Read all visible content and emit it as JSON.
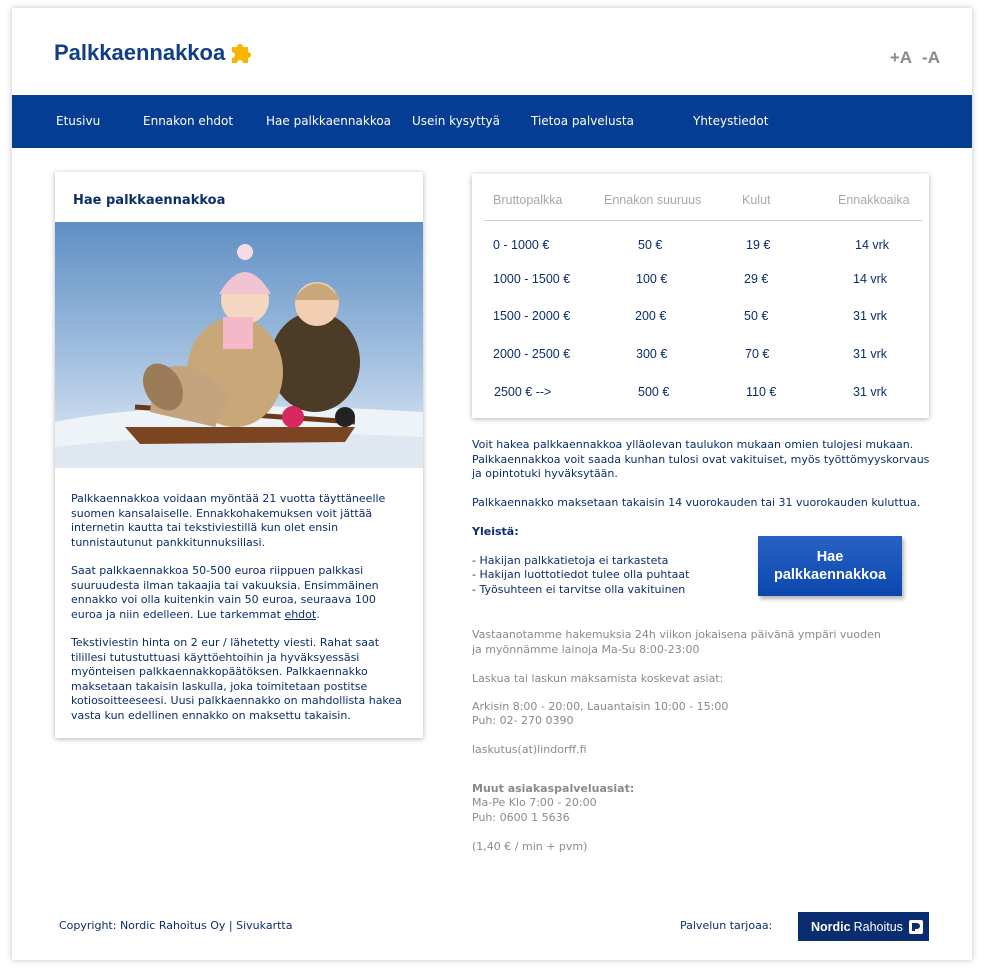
{
  "header": {
    "logo_text": "Palkkaennakkoa",
    "font_increase": "+A",
    "font_decrease": "-A"
  },
  "nav": {
    "items": [
      "Etusivu",
      "Ennakon ehdot",
      "Hae palkkaennakkoa",
      "Usein kysyttyä",
      "Tietoa palvelusta",
      "Yhteystiedot"
    ]
  },
  "left": {
    "title": "Hae palkkaennakkoa",
    "p1": "Palkkaennakkoa voidaan myöntää 21 vuotta täyttäneelle suomen kansalaiselle. Ennakkohakemuksen voit jättää internetin kautta tai tekstiviestillä kun olet ensin tunnistautunut pankkitunnuksillasi.",
    "p2_before": "Saat palkkaennakkoa 50-500 euroa riippuen palkkasi suuruudesta ilman takaajia tai vakuuksia. Ensimmäinen ennakko voi olla kuitenkin vain 50 euroa, seuraava 100 euroa ja niin edelleen. Lue tarkemmat ",
    "p2_link": "ehdot",
    "p2_after": ".",
    "p3": "Tekstiviestin hinta on 2 eur / lähetetty viesti. Rahat saat tilillesi tutustuttuasi käyttöehtoihin ja hyväksyessäsi myönteisen palkkaennakkopäätöksen. Palkkaennakko maksetaan takaisin laskulla, joka toimitetaan postitse kotiosoitteeseesi. Uusi palkkaennakko on mahdollista hakea vasta kun edellinen ennakko on maksettu takaisin."
  },
  "table": {
    "headers": [
      "Bruttopalkka",
      "Ennakon suuruus",
      "Kulut",
      "Ennakkoaika"
    ],
    "rows": [
      [
        "0 - 1000 €",
        "50 €",
        "19 €",
        "14 vrk"
      ],
      [
        "1000 - 1500 €",
        "100 €",
        "29 €",
        "14 vrk"
      ],
      [
        "1500 - 2000 €",
        "200 €",
        "50 €",
        "31 vrk"
      ],
      [
        "2000 - 2500 €",
        "300 €",
        "70 €",
        "31 vrk"
      ],
      [
        "2500 € -->",
        "500 €",
        "110 €",
        "31 vrk"
      ]
    ]
  },
  "right": {
    "intro1": "Voit hakea palkkaennakkoa ylläolevan taulukon mukaan omien tulojesi mukaan. Palkkaennakkoa voit saada kunhan tulosi ovat vakituiset, myös työttömyyskorvaus ja opintotuki hyväksytään.",
    "intro2": "Palkkaennakko maksetaan takaisin 14 vuorokauden tai 31 vuorokauden kuluttua.",
    "general_title": "Yleistä:",
    "general_items": [
      "- Hakijan palkkatietoja ei tarkasteta",
      "- Hakijan luottotiedot tulee olla puhtaat",
      "- Työsuhteen ei tarvitse olla vakituinen"
    ],
    "cta_line1": "Hae",
    "cta_line2": "palkkaennakkoa",
    "info1": "Vastaanotamme hakemuksia 24h viikon jokaisena päivänä ympäri vuoden ja myönnämme lainoja Ma-Su 8:00-23:00",
    "info2": "Laskua tai laskun maksamista koskevat asiat:",
    "info3a": "Arkisin 8:00 - 20:00, Lauantaisin 10:00 - 15:00",
    "info3b": "Puh: 02- 270 0390",
    "info4": "laskutus(at)lindorff.fi",
    "other_title": "Muut asiakaspalveluasiat:",
    "other_hours": "Ma-Pe Klo 7:00 - 20:00",
    "other_phone": "Puh: 0600 1 5636",
    "price": "(1,40 € / min + pvm)"
  },
  "footer": {
    "copyright": "Copyright: Nordic Rahoitus Oy",
    "separator": "|",
    "sitemap": "Sivukartta",
    "provider_label": "Palvelun tarjoaa:",
    "provider_bold": "Nordic",
    "provider_rest": "Rahoitus"
  },
  "colors": {
    "nav_bg": "#043d93",
    "text_blue": "#0b2e6b",
    "logo_puzzle": "#f7b500"
  }
}
